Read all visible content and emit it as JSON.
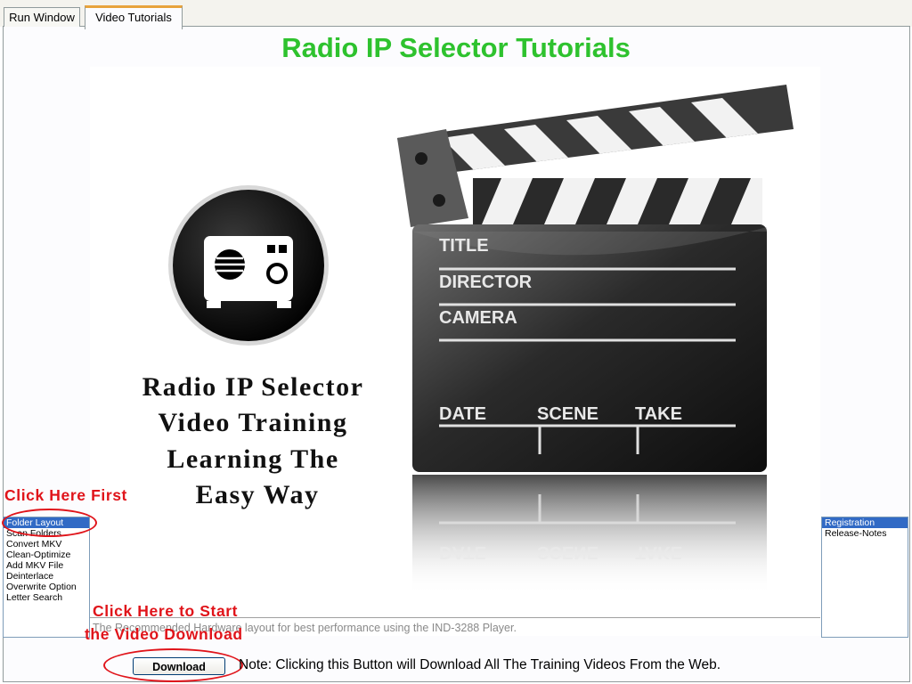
{
  "tabs": [
    {
      "label": "Run Window"
    },
    {
      "label": "Video Tutorials"
    }
  ],
  "header": {
    "title": "Radio IP Selector Tutorials"
  },
  "title_card": {
    "lines": [
      "Radio IP Selector",
      "Video Training",
      "Learning The",
      "Easy Way"
    ],
    "clapper_fields": [
      "TITLE",
      "DIRECTOR",
      "CAMERA",
      "DATE",
      "SCENE",
      "TAKE"
    ],
    "icon": "radio-icon"
  },
  "left_list": {
    "items": [
      "Folder Layout",
      "Scan Folders",
      "Convert MKV",
      "Clean-Optimize",
      "Add MKV File",
      "Deinterlace",
      "Overwrite Option",
      "Letter Search"
    ],
    "selected": "Folder Layout"
  },
  "right_list": {
    "items": [
      "Registration",
      "Release-Notes"
    ],
    "selected": "Registration"
  },
  "caption": "The Recommended Hardware layout for best performance using the IND-3288 Player.",
  "annotations": {
    "click_first": "Click Here First",
    "click_start_1": "Click Here to Start",
    "click_start_2": "the Video Download"
  },
  "footer": {
    "download_label": "Download",
    "note": "Note: Clicking this Button will Download All The Training Videos From the Web."
  },
  "colors": {
    "title": "#2ec22e",
    "annotation": "#e0141a",
    "selection": "#316ac5"
  }
}
